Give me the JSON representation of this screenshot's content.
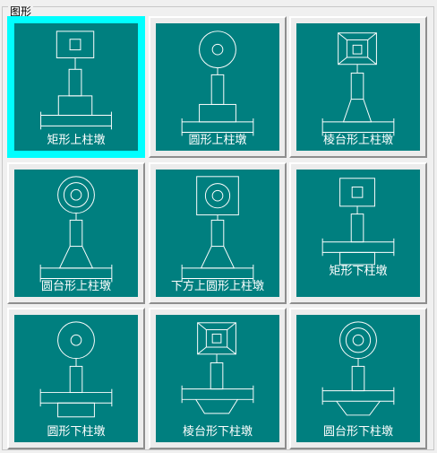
{
  "group_title": "图形",
  "selected_index": 0,
  "tiles": [
    {
      "label": "矩形上柱墩",
      "icon": "rect-pier-top-icon"
    },
    {
      "label": "圆形上柱墩",
      "icon": "round-pier-top-icon"
    },
    {
      "label": "棱台形上柱墩",
      "icon": "prism-pier-top-icon"
    },
    {
      "label": "圆台形上柱墩",
      "icon": "frustum-pier-top-icon"
    },
    {
      "label": "下方上圆形上柱墩",
      "icon": "square-base-round-top-pier-icon"
    },
    {
      "label": "矩形下柱墩",
      "icon": "rect-pier-bottom-icon"
    },
    {
      "label": "圆形下柱墩",
      "icon": "round-pier-bottom-icon"
    },
    {
      "label": "棱台形下柱墩",
      "icon": "prism-pier-bottom-icon"
    },
    {
      "label": "圆台形下柱墩",
      "icon": "frustum-pier-bottom-icon"
    }
  ],
  "colors": {
    "panel": "#007f7f",
    "selection": "#00ffff",
    "line": "#ffffff"
  }
}
